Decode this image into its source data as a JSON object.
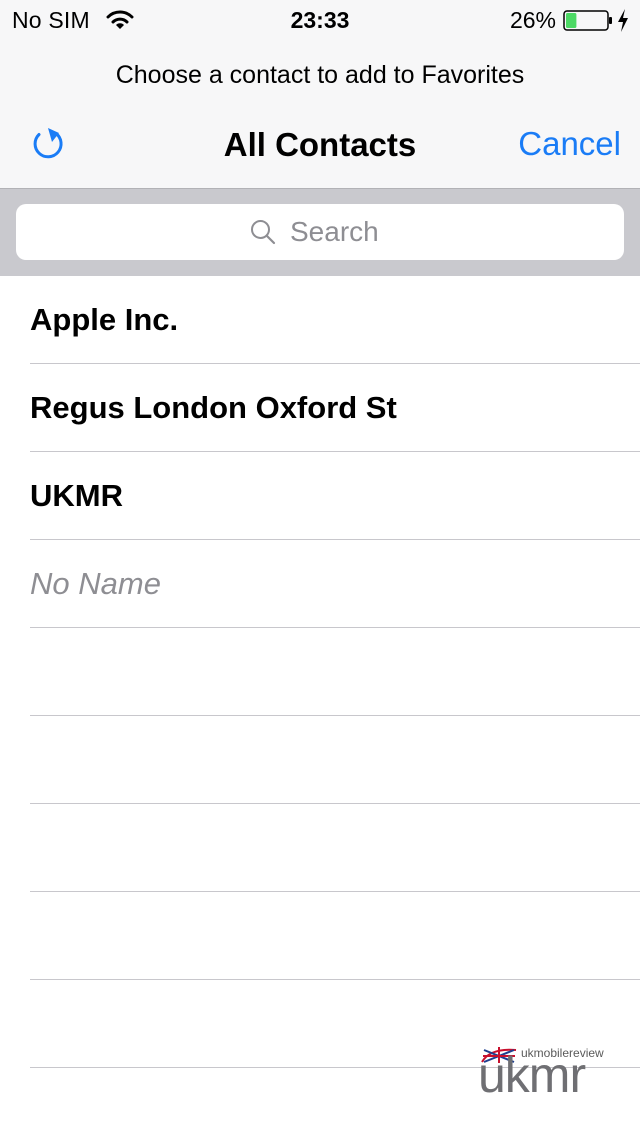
{
  "status_bar": {
    "carrier": "No SIM",
    "time": "23:33",
    "battery_percent": "26%",
    "battery_level": 0.26,
    "icons": [
      "wifi-icon",
      "battery-icon",
      "charging-icon"
    ]
  },
  "header": {
    "prompt": "Choose a contact to add to Favorites",
    "title": "All Contacts",
    "cancel_label": "Cancel",
    "refresh_icon": "refresh-icon"
  },
  "search": {
    "placeholder": "Search",
    "value": "",
    "icon": "search-icon"
  },
  "contacts": [
    {
      "name": "Apple Inc."
    },
    {
      "name": "Regus London Oxford St"
    },
    {
      "name": "UKMR"
    },
    {
      "name": "No Name"
    }
  ],
  "watermark": {
    "small_text": "ukmobilereview",
    "logo_text": "ukmr"
  },
  "colors": {
    "accent": "#1a7cf6",
    "battery_fill": "#4cd964",
    "placeholder": "#8e8e93",
    "search_band": "#c9c9ce"
  }
}
